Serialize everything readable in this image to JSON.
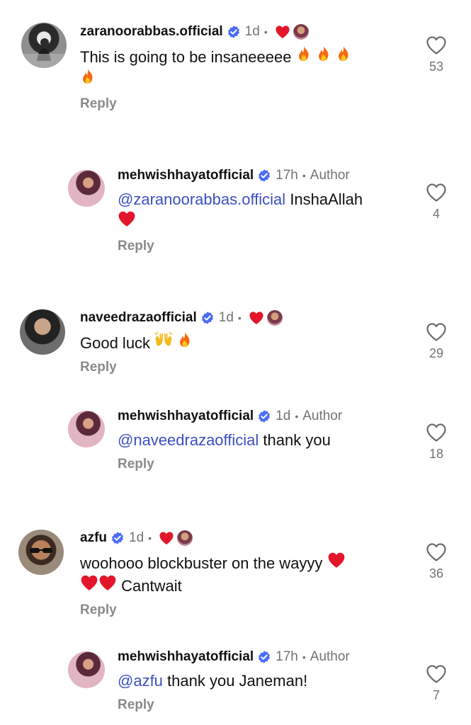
{
  "comments": [
    {
      "username": "zaranoorabbas.official",
      "time": "1d",
      "text_lines": [
        "This is going to be insaneeeee",
        ""
      ],
      "reply_label": "Reply",
      "likes": "53"
    },
    {
      "username": "mehwishhayatofficial",
      "time": "17h",
      "author_label": "Author",
      "mention": "@zaranoorabbas.official",
      "text": "InshaAllah",
      "reply_label": "Reply",
      "likes": "4"
    },
    {
      "username": "naveedrazaofficial",
      "time": "1d",
      "text": "Good luck",
      "reply_label": "Reply",
      "likes": "29"
    },
    {
      "username": "mehwishhayatofficial",
      "time": "1d",
      "author_label": "Author",
      "mention": "@naveedrazaofficial",
      "text": "thank you",
      "reply_label": "Reply",
      "likes": "18"
    },
    {
      "username": "azfu",
      "time": "1d",
      "text_line1": "woohooo blockbuster on the wayyy",
      "text_line2": "Cantwait",
      "reply_label": "Reply",
      "likes": "36"
    },
    {
      "username": "mehwishhayatofficial",
      "time": "17h",
      "author_label": "Author",
      "mention": "@azfu",
      "text": "thank you Janeman!",
      "reply_label": "Reply",
      "likes": "7"
    }
  ],
  "dot": "•",
  "colors": {
    "verified": "#4a6cf7",
    "heart_red": "#e3162b",
    "mention": "#3d4fc4",
    "muted": "#737373"
  },
  "icons": [
    "verified-badge-icon",
    "heart-outline-icon",
    "red-heart-icon",
    "fire-emoji-icon",
    "raised-hands-emoji-icon"
  ]
}
